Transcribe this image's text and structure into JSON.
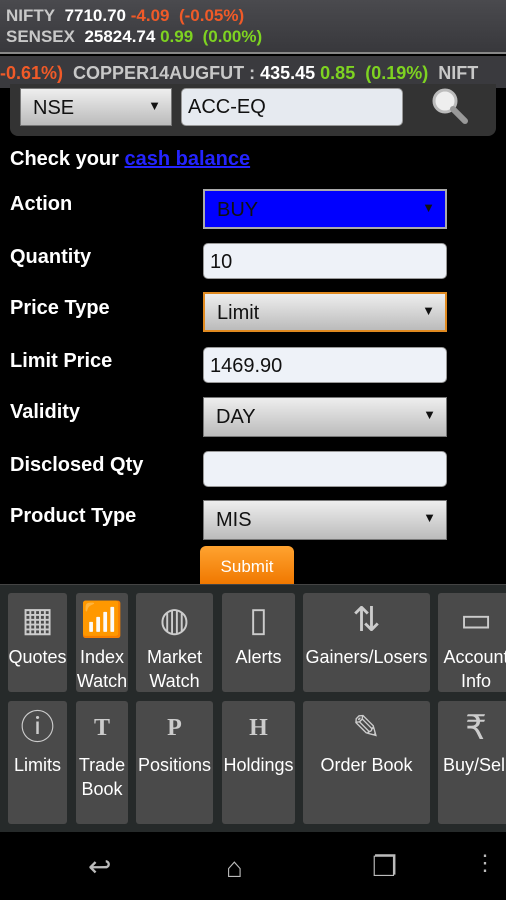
{
  "ticker": {
    "rows": [
      {
        "name": "NIFTY",
        "value": "7710.70",
        "change": "-4.09",
        "pct": "(-0.05%)",
        "dir": "neg"
      },
      {
        "name": "SENSEX",
        "value": "25824.74",
        "change": "0.99",
        "pct": "(0.00%)",
        "dir": "pos"
      }
    ]
  },
  "scroll": {
    "lead_pct": "-0.61%)",
    "name": "COPPER14AUGFUT :",
    "value": "435.45",
    "change": "0.85",
    "pct": "(0.19%)",
    "next": "NIFT"
  },
  "search": {
    "exchange": "NSE",
    "symbol": "ACC-EQ",
    "icon": "search-icon"
  },
  "cash": {
    "prefix": "Check your ",
    "link": "cash balance"
  },
  "form": {
    "action": {
      "label": "Action",
      "value": "BUY"
    },
    "quantity": {
      "label": "Quantity",
      "value": "10"
    },
    "price_type": {
      "label": "Price Type",
      "value": "Limit"
    },
    "limit_price": {
      "label": "Limit Price",
      "value": "1469.90"
    },
    "validity": {
      "label": "Validity",
      "value": "DAY"
    },
    "disclosed_qty": {
      "label": "Disclosed Qty",
      "value": ""
    },
    "product_type": {
      "label": "Product Type",
      "value": "MIS"
    },
    "submit": "Submit"
  },
  "menu": [
    {
      "label": "Quotes",
      "icon": "quotes-icon"
    },
    {
      "label": "Index Watch",
      "icon": "chart-icon"
    },
    {
      "label": "Market Watch",
      "icon": "globe-icon"
    },
    {
      "label": "Alerts",
      "icon": "phone-icon"
    },
    {
      "label": "Gainers/Losers",
      "icon": "arrows-icon"
    },
    {
      "label": "Account Info",
      "icon": "id-card-icon"
    },
    {
      "label": "Limits",
      "icon": "info-icon"
    },
    {
      "label": "Trade Book",
      "icon": "notebook-t-icon"
    },
    {
      "label": "Positions",
      "icon": "notebook-p-icon"
    },
    {
      "label": "Holdings",
      "icon": "notebook-h-icon"
    },
    {
      "label": "Order Book",
      "icon": "notebook-pen-icon"
    },
    {
      "label": "Buy/Sell",
      "icon": "rupee-icon"
    }
  ],
  "colors": {
    "buy": "#0000ff",
    "submit": "#f58a10",
    "positive": "#7ed321",
    "negative": "#f05a28"
  }
}
